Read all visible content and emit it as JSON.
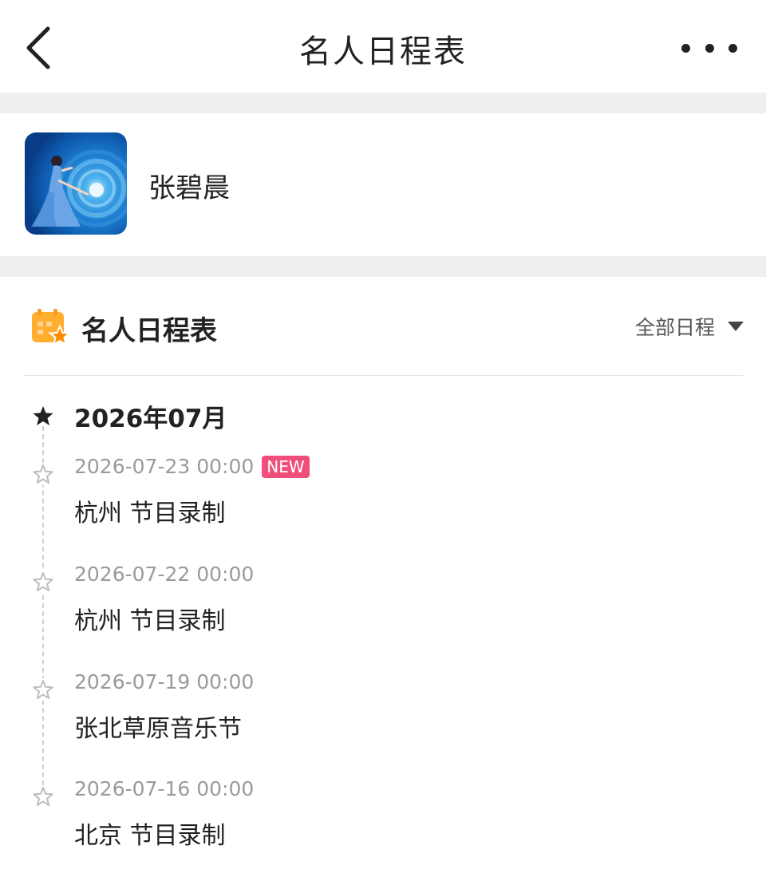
{
  "navbar": {
    "title": "名人日程表",
    "back_icon": "chevron-left-icon",
    "more_icon": "more-horizontal-icon"
  },
  "celebrity": {
    "name": "张碧晨"
  },
  "schedule": {
    "section_title": "名人日程表",
    "section_icon": "calendar-star-icon",
    "filter_label": "全部日程",
    "month": "2026年07月",
    "events": [
      {
        "date": "2026-07-23 00:00",
        "badge": "NEW",
        "title": "杭州 节目录制"
      },
      {
        "date": "2026-07-22 00:00",
        "title": "杭州 节目录制"
      },
      {
        "date": "2026-07-19 00:00",
        "title": "张北草原音乐节"
      },
      {
        "date": "2026-07-16 00:00",
        "title": "北京 节目录制"
      }
    ]
  },
  "colors": {
    "accent_orange": "#ff9a1f",
    "new_badge": "#ef4f7a",
    "muted_text": "#9a9a9a",
    "separator": "#efefef"
  }
}
